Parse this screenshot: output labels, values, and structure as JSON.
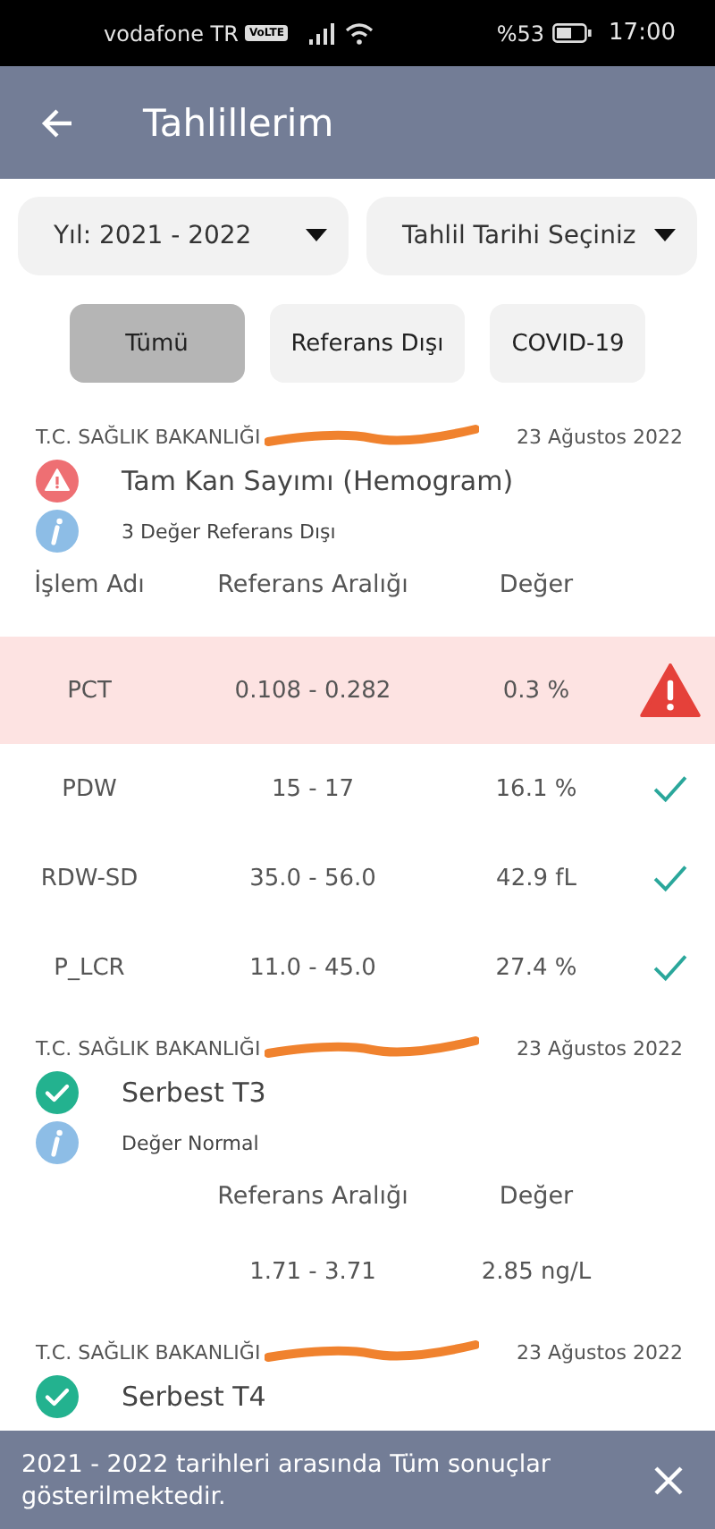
{
  "status_bar": {
    "carrier": "vodafone TR",
    "network_badge": "VoLTE",
    "battery": "%53",
    "time": "17:00"
  },
  "app_bar": {
    "title": "Tahlillerim"
  },
  "filters": [
    {
      "label": "Yıl: 2021 - 2022"
    },
    {
      "label": "Tahlil Tarihi Seçiniz"
    }
  ],
  "tabs": [
    {
      "label": "Tümü",
      "selected": true
    },
    {
      "label": "Referans Dışı",
      "selected": false
    },
    {
      "label": "COVID-19",
      "selected": false
    }
  ],
  "results": [
    {
      "source": "T.C. SAĞLIK BAKANLIĞI",
      "date": "23 Ağustos 2022",
      "out_of_range": true,
      "title": "Tam Kan Sayımı (Hemogram)",
      "summary": "3 Değer Referans Dışı",
      "columns": {
        "name": "İşlem Adı",
        "range": "Referans Aralığı",
        "value": "Değer"
      },
      "rows": [
        {
          "name": "PCT",
          "range": "0.108 - 0.282",
          "value": "0.3 %",
          "out_of_range": true
        },
        {
          "name": "PDW",
          "range": "15 - 17",
          "value": "16.1 %",
          "out_of_range": false
        },
        {
          "name": "RDW-SD",
          "range": "35.0 - 56.0",
          "value": "42.9 fL",
          "out_of_range": false
        },
        {
          "name": "P_LCR",
          "range": "11.0 - 45.0",
          "value": "27.4 %",
          "out_of_range": false
        }
      ]
    },
    {
      "source": "T.C. SAĞLIK BAKANLIĞI",
      "date": "23 Ağustos 2022",
      "out_of_range": false,
      "title": "Serbest T3",
      "summary": "Değer Normal",
      "columns": {
        "range": "Referans Aralığı",
        "value": "Değer"
      },
      "rows": [
        {
          "range": "1.71 - 3.71",
          "value": "2.85 ng/L"
        }
      ]
    },
    {
      "source": "T.C. SAĞLIK BAKANLIĞI",
      "date": "23 Ağustos 2022",
      "out_of_range": false,
      "title": "Serbest T4"
    }
  ],
  "snackbar": {
    "message": "2021 - 2022 tarihleri arasında Tüm sonuçlar gösterilmektedir."
  }
}
